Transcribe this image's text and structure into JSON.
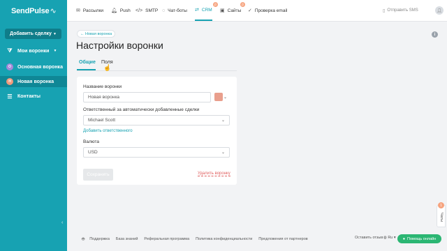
{
  "app": {
    "logo": "SendPulse",
    "logo_mark": "~✧"
  },
  "sidebar": {
    "add_deal": "Добавить сделку",
    "my_funnels": "Мои воронки",
    "items": [
      {
        "badge": "О",
        "label": "Основная воронка",
        "color": "#a58ad8"
      },
      {
        "badge": "Н",
        "label": "Новая воронка",
        "color": "#f29a7c"
      }
    ],
    "contacts": "Контакты"
  },
  "topnav": {
    "items": [
      {
        "icon": "mail-icon",
        "label": "Рассылки"
      },
      {
        "icon": "bell-icon",
        "label": "Push"
      },
      {
        "icon": "code-icon",
        "label": "SMTP"
      },
      {
        "icon": "chat-icon",
        "label": "Чат-боты"
      },
      {
        "icon": "crm-icon",
        "label": "CRM",
        "badge": "β"
      },
      {
        "icon": "sites-icon",
        "label": "Сайты",
        "badge": "β"
      },
      {
        "icon": "check-icon",
        "label": "Проверка email"
      }
    ],
    "send_sms": "Отправить SMS"
  },
  "page": {
    "back": "← Новая воронка",
    "title": "Настройки воронки",
    "tabs": [
      "Общие",
      "Поля"
    ]
  },
  "form": {
    "name_label": "Название воронки",
    "name_value": "Новая воронка",
    "responsible_label": "Ответственный за автоматически добавленные сделки",
    "responsible_value": "Michael Scott",
    "add_responsible": "Добавить ответственного",
    "currency_label": "Валюта",
    "currency_value": "USD",
    "save": "Сохранить",
    "delete": "Удалить воронку",
    "swatch_color": "#e99f8d"
  },
  "footer": {
    "links": [
      "Поддержка",
      "База знаний",
      "Реферальная программа",
      "Политика конфиденциальности",
      "Предложения от партнеров"
    ],
    "feedback": "Оставить отзыв",
    "lang": "Ru",
    "help": "Помощь онлайн",
    "chats": "Чаты",
    "chats_count": "1"
  },
  "colors": {
    "accent": "#17a2b2",
    "sidebar": "#17a2b2",
    "help": "#2bb673"
  }
}
